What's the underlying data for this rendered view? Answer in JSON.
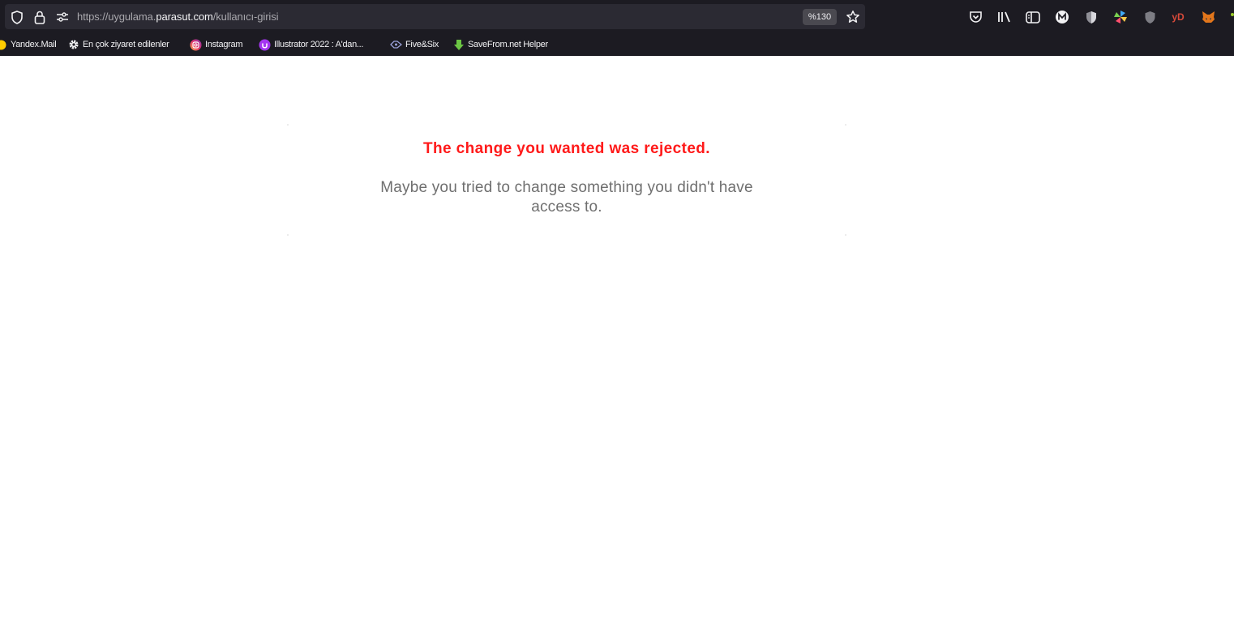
{
  "browser": {
    "url": {
      "prefix": "https://uygulama.",
      "domain": "parasut.com",
      "path": "/kullanıcı-girisi"
    },
    "zoom": "%130",
    "icons": {
      "shield": "tracking-protection-icon",
      "lock": "lock-icon",
      "permissions": "permissions-icon",
      "star": "bookmark-star-icon",
      "pocket": "pocket-icon",
      "library": "library-icon",
      "sidebar": "sidebar-icon",
      "extensions": [
        "m-extension-icon",
        "shield-extension-icon",
        "pinwheel-extension-icon",
        "grey-shield-extension-icon",
        "yd-extension-icon",
        "metamask-fox-icon"
      ]
    },
    "ext_yd_label": "yD",
    "colors": {
      "chrome_bg": "#1c1b22",
      "urlbar_bg": "#2b2a33"
    }
  },
  "bookmarks": [
    {
      "label": "Yandex.Mail",
      "icon": "yandex-mail-icon"
    },
    {
      "label": "En çok ziyaret edilenler",
      "icon": "gear-icon"
    },
    {
      "label": "Instagram",
      "icon": "instagram-icon"
    },
    {
      "label": "Illustrator 2022 : A'dan...",
      "icon": "udemy-icon"
    },
    {
      "label": "Five&Six",
      "icon": "fivesix-icon"
    },
    {
      "label": "SaveFrom.net Helper",
      "icon": "savefrom-download-icon"
    }
  ],
  "page": {
    "error_title": "The change you wanted was rejected.",
    "error_message": "Maybe you tried to change something you didn't have access to.",
    "colors": {
      "title": "#ff1a1a",
      "message": "#6f6f6f"
    }
  }
}
